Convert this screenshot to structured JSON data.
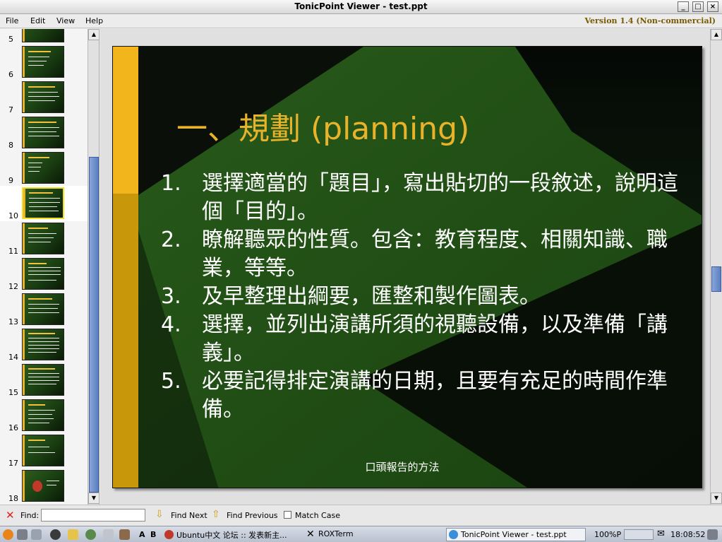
{
  "window": {
    "title": "TonicPoint Viewer - test.ppt"
  },
  "menu": {
    "items": [
      {
        "label": "File"
      },
      {
        "label": "Edit"
      },
      {
        "label": "View"
      },
      {
        "label": "Help"
      }
    ],
    "version": "Version 1.4 (Non-commercial)"
  },
  "sidebar": {
    "thumbnails": [
      {
        "number": "5",
        "selected": false
      },
      {
        "number": "6",
        "selected": false
      },
      {
        "number": "7",
        "selected": false
      },
      {
        "number": "8",
        "selected": false
      },
      {
        "number": "9",
        "selected": false
      },
      {
        "number": "10",
        "selected": true
      },
      {
        "number": "11",
        "selected": false
      },
      {
        "number": "12",
        "selected": false
      },
      {
        "number": "13",
        "selected": false
      },
      {
        "number": "14",
        "selected": false
      },
      {
        "number": "15",
        "selected": false
      },
      {
        "number": "16",
        "selected": false
      },
      {
        "number": "17",
        "selected": false
      },
      {
        "number": "18",
        "selected": false
      }
    ]
  },
  "slide": {
    "title": "一、規劃 (planning)",
    "items": [
      {
        "num": "1.",
        "text": "選擇適當的「題目」，寫出貼切的一段敘述，說明這個「目的」。"
      },
      {
        "num": "2.",
        "text": "瞭解聽眾的性質。包含：教育程度、相關知識、職業，等等。"
      },
      {
        "num": "3.",
        "text": "及早整理出綱要，匯整和製作圖表。"
      },
      {
        "num": "4.",
        "text": "選擇，並列出演講所須的視聽設備，以及準備「講義」。"
      },
      {
        "num": "5.",
        "text": "必要記得排定演講的日期，且要有充足的時間作準備。"
      }
    ],
    "footer": "口頭報告的方法",
    "colors": {
      "accent_bar": "#e8b32a",
      "title": "#e8b32a",
      "background_green": "#1f4a14"
    }
  },
  "findbar": {
    "close_icon": "close-x-icon",
    "label": "Find:",
    "value": "",
    "find_next": "Find Next",
    "find_previous": "Find Previous",
    "match_case": "Match Case",
    "match_case_checked": false
  },
  "taskbar": {
    "input_a": "A",
    "input_b": "B",
    "tasks": [
      {
        "label": "Ubuntu中文 论坛 :: 发表新主..."
      },
      {
        "label": "ROXTerm"
      },
      {
        "label": "TonicPoint Viewer - test.ppt"
      }
    ],
    "zoom": "100%P",
    "clock": "18:08:52"
  }
}
